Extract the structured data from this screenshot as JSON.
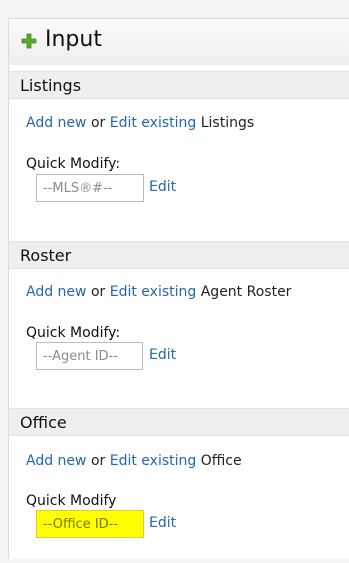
{
  "header": {
    "title": "Input",
    "icon": "plus-icon"
  },
  "sections": [
    {
      "title": "Listings",
      "add_new": "Add new",
      "or": " or ",
      "edit_existing": "Edit existing",
      "target": " Listings",
      "quick_modify_label": "Quick Modify:",
      "input_placeholder": "--MLS®#--",
      "edit_label": "Edit"
    },
    {
      "title": "Roster",
      "add_new": "Add new",
      "or": " or ",
      "edit_existing": "Edit existing",
      "target": " Agent Roster",
      "quick_modify_label": "Quick Modify:",
      "input_placeholder": "--Agent ID--",
      "edit_label": "Edit"
    },
    {
      "title": "Office",
      "add_new": "Add new",
      "or": " or ",
      "edit_existing": "Edit existing",
      "target": " Office",
      "quick_modify_label": "Quick Modify",
      "input_placeholder": "--Office ID--",
      "edit_label": "Edit"
    }
  ],
  "colors": {
    "link": "#2466b0",
    "highlight": "#ffff00",
    "accent_green": "#5aa832"
  }
}
